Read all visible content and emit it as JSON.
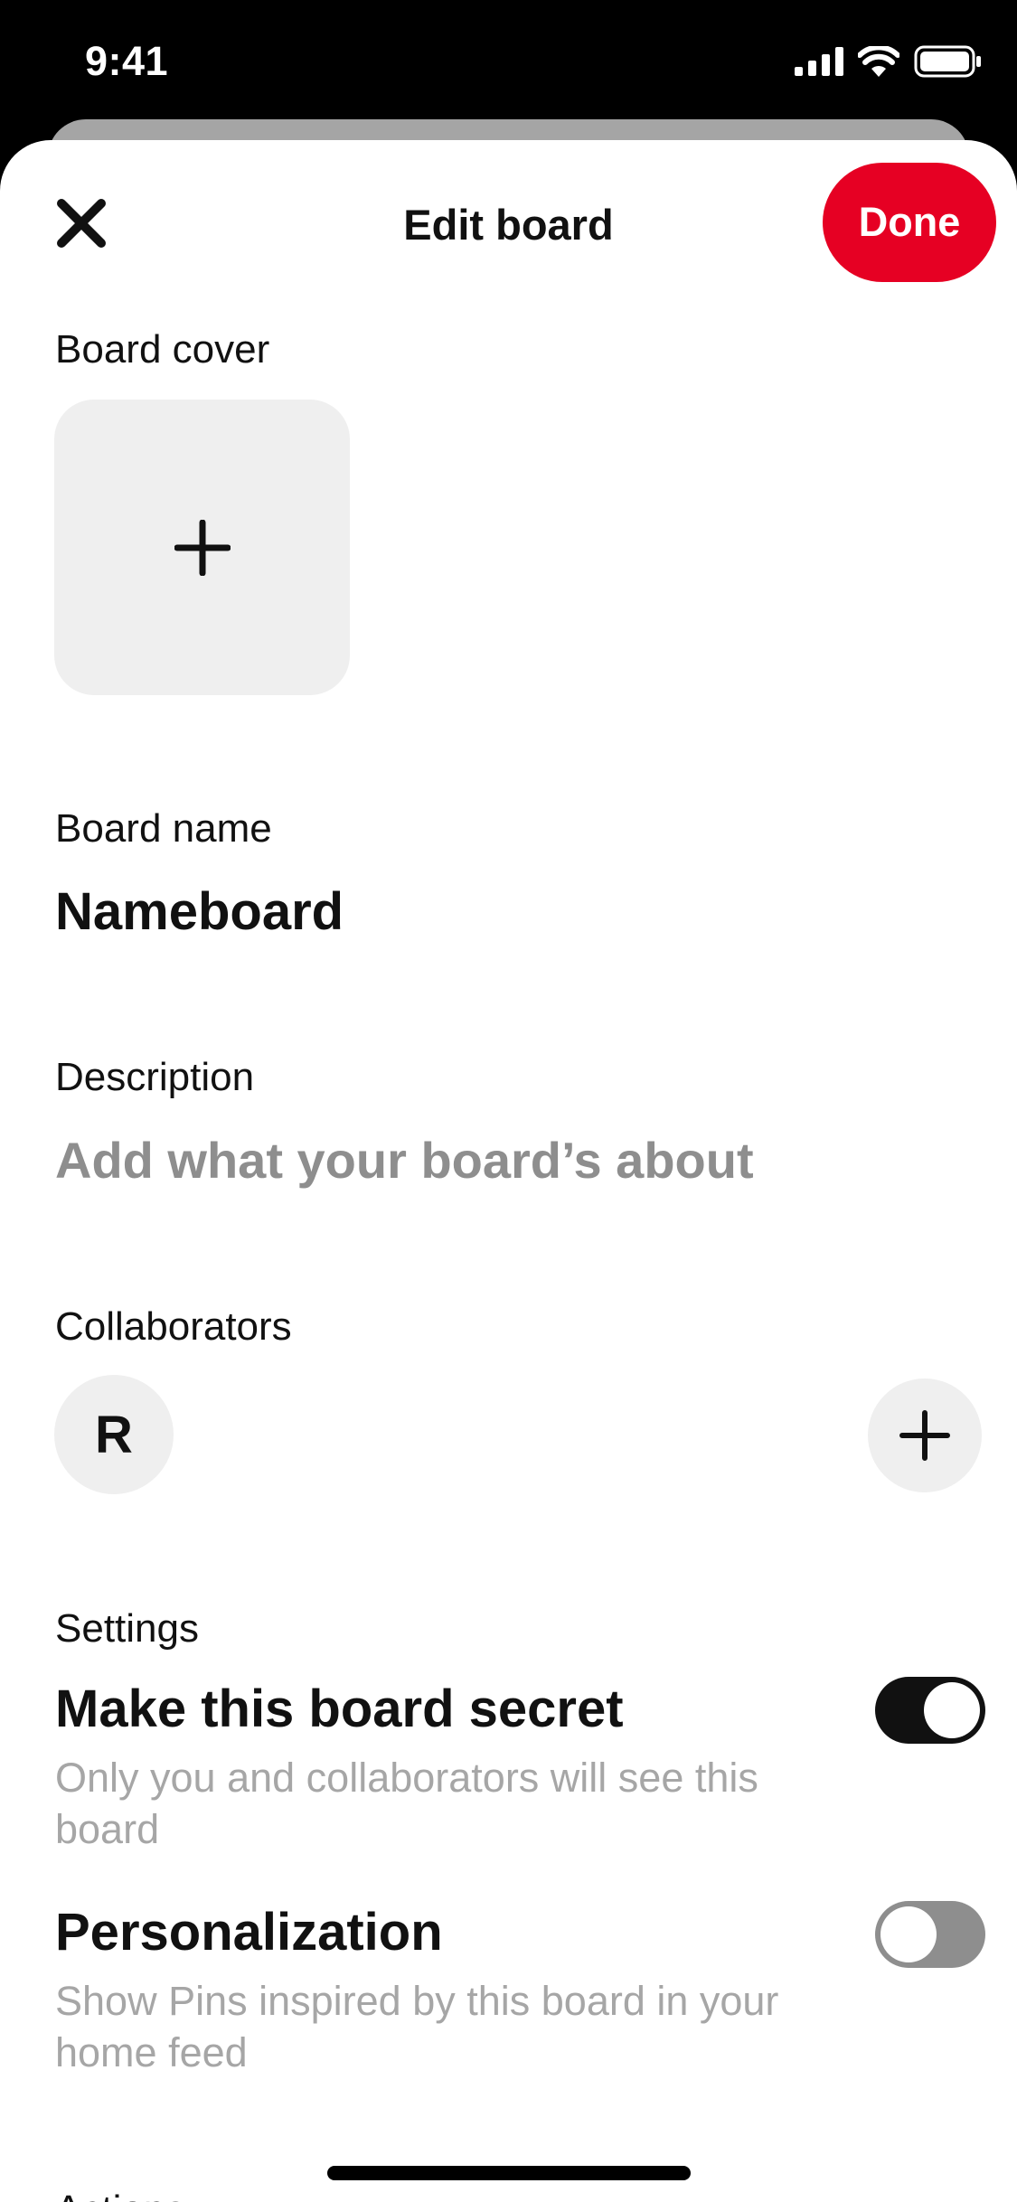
{
  "status_bar": {
    "time": "9:41"
  },
  "header": {
    "title": "Edit board",
    "done_label": "Done",
    "close_icon": "close-icon"
  },
  "board_cover": {
    "label": "Board cover",
    "add_icon": "plus-icon"
  },
  "board_name": {
    "label": "Board name",
    "value": "Nameboard"
  },
  "description": {
    "label": "Description",
    "placeholder": "Add what your board’s about"
  },
  "collaborators": {
    "label": "Collaborators",
    "avatar_initial": "R",
    "add_icon": "plus-icon"
  },
  "settings": {
    "label": "Settings",
    "items": [
      {
        "title": "Make this board secret",
        "description": "Only you and collaborators will see this board",
        "enabled": true
      },
      {
        "title": "Personalization",
        "description": "Show Pins inspired by this board in your home feed",
        "enabled": false
      }
    ]
  },
  "next_section": {
    "label": "Actions"
  },
  "colors": {
    "accent": "#e60023",
    "toggle_on": "#111111",
    "toggle_off": "#8e8e8e",
    "placeholder": "#8e8e8e"
  }
}
